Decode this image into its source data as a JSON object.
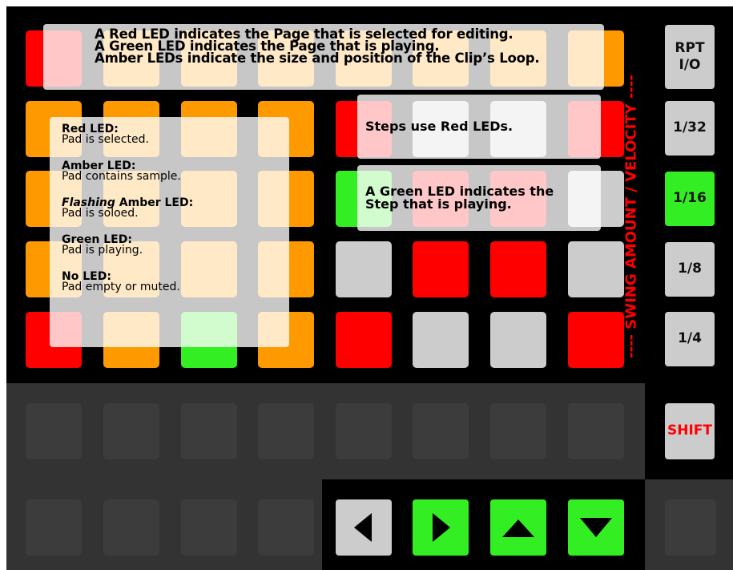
{
  "top_overlay": {
    "line1": "A Red LED indicates the Page that is selected for editing.",
    "line2": "A Green LED indicates the Page that is playing.",
    "line3": "Amber LEDs indicate the size and position of the Clip’s Loop."
  },
  "left_overlay": {
    "red_head": "Red LED:",
    "red_desc": "Pad is selected.",
    "amber_head": "Amber LED:",
    "amber_desc": "Pad contains sample.",
    "flash_word": "Flashing",
    "flash_rest": " Amber LED:",
    "flash_desc": "Pad is soloed.",
    "green_head": "Green LED:",
    "green_desc": "Pad is playing.",
    "none_head": "No LED:",
    "none_desc": "Pad empty or muted."
  },
  "right_overlay": {
    "steps_text": "Steps use Red LEDs.",
    "green_line1": "A Green LED indicates the",
    "green_line2": "Step that is playing."
  },
  "side_buttons": {
    "rpt_line1": "RPT",
    "rpt_line2": "I/O",
    "b132": "1/32",
    "b116": "1/16",
    "b18": "1/8",
    "b14": "1/4",
    "shift": "SHIFT"
  },
  "vertical_label": "---- SWING AMOUNT / VELOCITY ----",
  "colors": {
    "red": "#ff0000",
    "amber": "#ff9900",
    "green": "#33ee22",
    "light_gray": "#cccccc",
    "label_red": "#ff0000"
  },
  "arrows": [
    "left-arrow-icon",
    "right-arrow-icon",
    "up-arrow-icon",
    "down-arrow-icon"
  ]
}
